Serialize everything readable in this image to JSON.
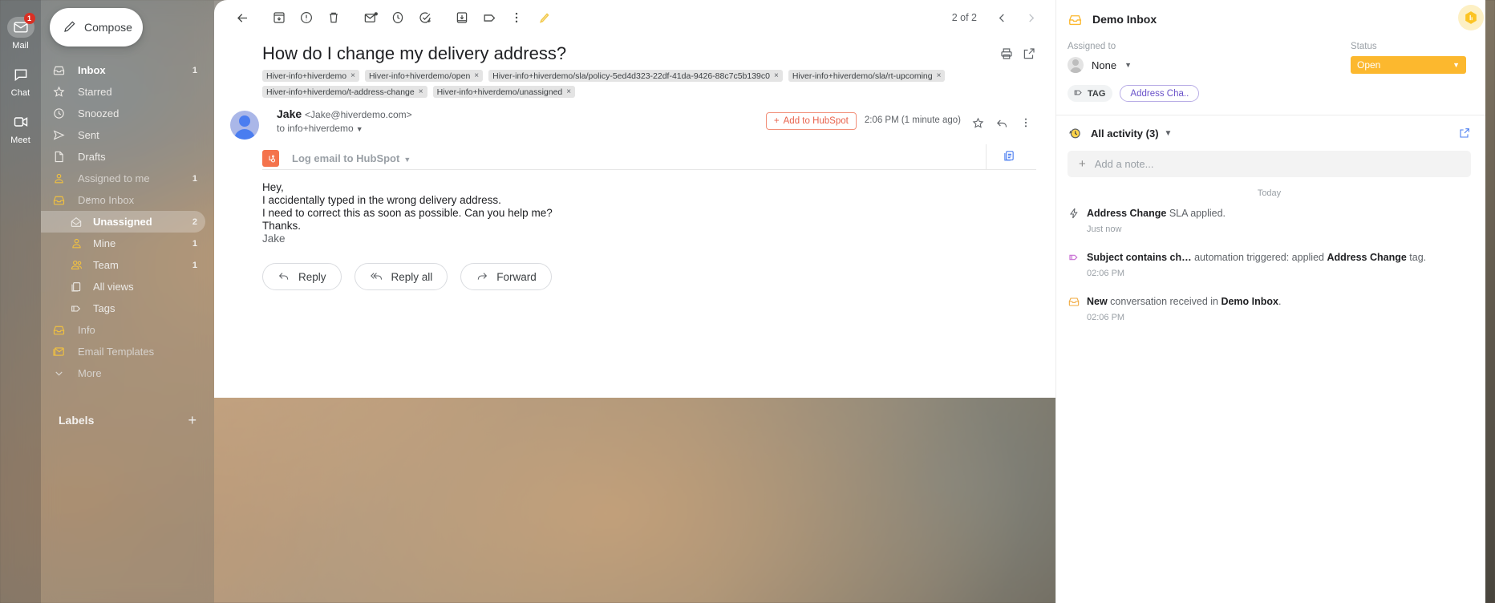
{
  "rail": {
    "items": [
      {
        "label": "Mail",
        "icon": "mail-icon",
        "badge": "1",
        "active": true
      },
      {
        "label": "Chat",
        "icon": "chat-icon",
        "badge": "",
        "active": false
      },
      {
        "label": "Meet",
        "icon": "meet-icon",
        "badge": "",
        "active": false
      }
    ]
  },
  "sidebar": {
    "compose_label": "Compose",
    "labels_header": "Labels",
    "items": [
      {
        "label": "Inbox",
        "count": "1",
        "icon": "inbox-icon",
        "style": "bold"
      },
      {
        "label": "Starred",
        "count": "",
        "icon": "star-icon",
        "style": ""
      },
      {
        "label": "Snoozed",
        "count": "",
        "icon": "clock-icon",
        "style": ""
      },
      {
        "label": "Sent",
        "count": "",
        "icon": "send-icon",
        "style": ""
      },
      {
        "label": "Drafts",
        "count": "",
        "icon": "draft-icon",
        "style": ""
      },
      {
        "label": "Assigned to me",
        "count": "1",
        "icon": "person-icon",
        "style": "dim"
      },
      {
        "label": "Demo Inbox",
        "count": "",
        "icon": "tray-icon",
        "style": "dim",
        "caret": "˅"
      },
      {
        "label": "Unassigned",
        "count": "2",
        "icon": "open-mail-icon",
        "style": "sel",
        "sub": true
      },
      {
        "label": "Mine",
        "count": "1",
        "icon": "person-icon",
        "style": "",
        "sub": true
      },
      {
        "label": "Team",
        "count": "1",
        "icon": "people-icon",
        "style": "",
        "sub": true
      },
      {
        "label": "All views",
        "count": "",
        "icon": "views-icon",
        "style": "",
        "sub": true
      },
      {
        "label": "Tags",
        "count": "",
        "icon": "tag-icon",
        "style": "",
        "sub": true
      },
      {
        "label": "Info",
        "count": "",
        "icon": "tray-icon",
        "style": "dim",
        "caret": "›"
      },
      {
        "label": "Email Templates",
        "count": "",
        "icon": "template-icon",
        "style": "dim"
      },
      {
        "label": "More",
        "count": "",
        "icon": "chevron-down-icon",
        "style": "dim"
      }
    ]
  },
  "toolbar": {
    "icons": [
      "back-icon",
      "archive-icon",
      "report-spam-icon",
      "delete-icon",
      "mark-unread-icon",
      "snooze-icon",
      "add-to-tasks-icon",
      "move-to-icon",
      "label-icon",
      "more-options-icon",
      "highlight-pencil-icon"
    ],
    "pager": "2 of 2",
    "prev_icon": "chevron-left-icon",
    "next_icon": "chevron-right-icon",
    "avatar_icon": "hiver-hex-avatar"
  },
  "thread": {
    "subject": "How do I change my delivery address?",
    "chips": [
      "Hiver-info+hiverdemo",
      "Hiver-info+hiverdemo/open",
      "Hiver-info+hiverdemo/sla/policy-5ed4d323-22df-41da-9426-88c7c5b139c0",
      "Hiver-info+hiverdemo/sla/rt-upcoming",
      "Hiver-info+hiverdemo/t-address-change",
      "Hiver-info+hiverdemo/unassigned"
    ],
    "chip_remove": "×",
    "print_icon": "print-icon",
    "popout_icon": "open-in-new-icon"
  },
  "message": {
    "sender_name": "Jake",
    "sender_email": "<Jake@hiverdemo.com>",
    "to_line": "to info+hiverdemo",
    "hubspot_button": "Add to HubSpot",
    "hubspot_plus": "+",
    "time": "2:06 PM (1 minute ago)",
    "star_icon": "star-icon",
    "reply_icon": "reply-arrow-icon",
    "more_icon": "more-options-icon",
    "log_label": "Log email to HubSpot",
    "copy_icon": "copy-icon",
    "body_lines": [
      "Hey,",
      "I accidentally typed in the wrong delivery address.",
      "I need to correct this as soon as possible. Can you help me?",
      "Thanks."
    ],
    "signature": "Jake",
    "actions": [
      {
        "label": "Reply",
        "icon": "reply-icon"
      },
      {
        "label": "Reply all",
        "icon": "reply-all-icon"
      },
      {
        "label": "Forward",
        "icon": "forward-icon"
      }
    ]
  },
  "right_panel": {
    "inbox_name": "Demo Inbox",
    "inbox_icon": "tray-icon",
    "menu_icon": "kebab-menu-icon",
    "assigned_label": "Assigned to",
    "assignee": "None",
    "status_label": "Status",
    "status_value": "Open",
    "tag_button": "TAG",
    "tag_icon": "tag-icon",
    "tag_chip": "Address Cha..",
    "activity_title": "All activity (3)",
    "activity_icon": "history-clock-icon",
    "activity_popout_icon": "open-in-new-icon",
    "add_note_placeholder": "Add a note...",
    "day_divider": "Today",
    "events": [
      {
        "icon": "bolt-icon",
        "bold_1": "Address Change",
        "text_1": " SLA applied.",
        "bold_2": "",
        "text_2": "",
        "time": "Just now"
      },
      {
        "icon": "tag-icon",
        "bold_1": "Subject contains ch…",
        "text_1": " automation triggered: applied ",
        "bold_2": "Address Change",
        "text_2": " tag.",
        "time": "02:06 PM"
      },
      {
        "icon": "mail-received-icon",
        "bold_1": "New",
        "text_1": " conversation received in ",
        "bold_2": "Demo Inbox",
        "text_2": ".",
        "time": "02:06 PM"
      }
    ]
  },
  "colors": {
    "accent_blue": "#4a7df0",
    "status_orange": "#fcb82e",
    "hubspot_orange": "#f4734c",
    "tag_purple": "#6a52c9",
    "badge_red": "#d93025"
  }
}
